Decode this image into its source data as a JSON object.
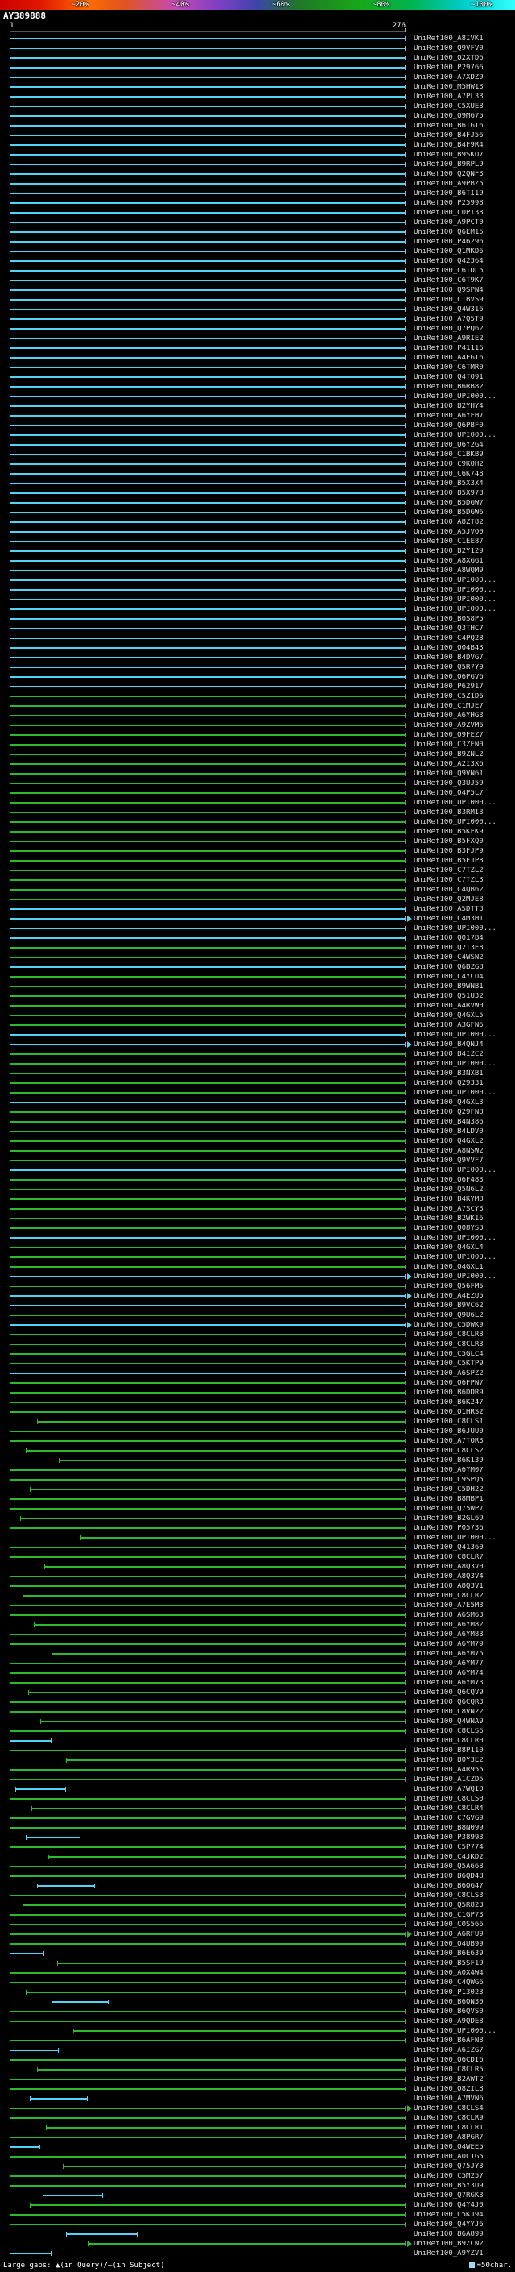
{
  "colors": {
    "high_identity": "#4fd4f7",
    "mid_identity": "#2db82d",
    "key_gradient": [
      "#cc0000",
      "#ff6a00",
      "#c44ab4",
      "#3c46a8",
      "#18a818",
      "#33ffff"
    ],
    "background": "#000000",
    "label_text": "#d8d8d8"
  },
  "footer": {
    "large_gaps_legend": "Large gaps: ▲(in Query)/—(in Subject)",
    "scale_legend": "=50char.",
    "scale_box_icon": "cyan-square"
  },
  "chart_data": {
    "type": "bar",
    "orientation": "horizontal",
    "title": "Sequence similarity hit overview (percent-identity colored alignments)",
    "query_name": "AY389888",
    "x_axis": {
      "min": 1,
      "max": 276,
      "start_label": "1",
      "end_label": "276"
    },
    "key": {
      "description": "percent identity color scale",
      "labels": [
        "~20%",
        "~40%",
        "~60%",
        "~80%",
        "~100%"
      ],
      "positions_pct": [
        15.5,
        35.0,
        54.5,
        74.0,
        93.5
      ]
    },
    "label_prefix": "UniRef100_",
    "bar_encoding": "[id, color(c=cyan ~100% identity, g=green ~60-80%), start, end, arrow_past_end]",
    "bars": [
      [
        "A8IVK1",
        "c"
      ],
      [
        "Q9VFV0",
        "c"
      ],
      [
        "Q2XTD6",
        "c"
      ],
      [
        "P29766",
        "c"
      ],
      [
        "A7XDZ9",
        "c"
      ],
      [
        "M5HW13",
        "c"
      ],
      [
        "A7PL33",
        "c"
      ],
      [
        "C5XUE8",
        "c"
      ],
      [
        "Q9M675",
        "c"
      ],
      [
        "B6TGT6",
        "c"
      ],
      [
        "B4FJ56",
        "c"
      ],
      [
        "B4F9R4",
        "c"
      ],
      [
        "B9SKO7",
        "c"
      ],
      [
        "B9RPL9",
        "c"
      ],
      [
        "Q2QNF3",
        "c"
      ],
      [
        "A9PBZ5",
        "c"
      ],
      [
        "B6TI19",
        "c"
      ],
      [
        "P25998",
        "c"
      ],
      [
        "C0PT38",
        "c"
      ],
      [
        "A9PCT0",
        "c"
      ],
      [
        "Q6EM15",
        "c"
      ],
      [
        "P46296",
        "c"
      ],
      [
        "Q1MKD6",
        "c"
      ],
      [
        "Q42364",
        "c"
      ],
      [
        "C6TDL5",
        "c"
      ],
      [
        "C6T9K7",
        "c"
      ],
      [
        "Q9SPN4",
        "c"
      ],
      [
        "C1BVS9",
        "c"
      ],
      [
        "Q4W316",
        "c"
      ],
      [
        "A7Q5T9",
        "c"
      ],
      [
        "Q7PQ62",
        "c"
      ],
      [
        "A9RIE2",
        "c"
      ],
      [
        "P41116",
        "c"
      ],
      [
        "A4FGI6",
        "c"
      ],
      [
        "C6TMR0",
        "c"
      ],
      [
        "Q4T091",
        "c"
      ],
      [
        "B6RB82",
        "c"
      ],
      [
        "UPI000...",
        "c"
      ],
      [
        "B2YHY4",
        "c"
      ],
      [
        "A6YFH7",
        "c"
      ],
      [
        "Q6PBF0",
        "c"
      ],
      [
        "UPI000...",
        "c"
      ],
      [
        "Q6Y2G4",
        "c"
      ],
      [
        "C1BKB9",
        "c"
      ],
      [
        "C9K0H2",
        "c"
      ],
      [
        "C6K748",
        "c"
      ],
      [
        "B5X3X4",
        "c"
      ],
      [
        "B5X978",
        "c"
      ],
      [
        "B5DGW7",
        "c"
      ],
      [
        "B5DGW6",
        "c"
      ],
      [
        "A8ZT82",
        "c"
      ],
      [
        "A5JVQ0",
        "c"
      ],
      [
        "C1EE87",
        "c"
      ],
      [
        "B2Y129",
        "c"
      ],
      [
        "A8XGG1",
        "c"
      ],
      [
        "A8WQM9",
        "c"
      ],
      [
        "UPI000...",
        "c"
      ],
      [
        "UPI000...",
        "c"
      ],
      [
        "UPI000...",
        "c"
      ],
      [
        "UPI000...",
        "c"
      ],
      [
        "B0S8P5",
        "c"
      ],
      [
        "Q3THC7",
        "c"
      ],
      [
        "C4PQ28",
        "c"
      ],
      [
        "Q04B43",
        "c"
      ],
      [
        "B4DVG7",
        "c"
      ],
      [
        "Q5R7Y0",
        "c"
      ],
      [
        "Q6PGV6",
        "c"
      ],
      [
        "P62917",
        "c"
      ],
      [
        "C5Z1D6",
        "g"
      ],
      [
        "C1MJE7",
        "g"
      ],
      [
        "A6YHG3",
        "g"
      ],
      [
        "A9ZVM6",
        "g"
      ],
      [
        "Q9FEZ7",
        "g"
      ],
      [
        "C3ZEN0",
        "g"
      ],
      [
        "B9ZNL2",
        "g"
      ],
      [
        "A2I3X6",
        "g"
      ],
      [
        "Q9VN61",
        "g"
      ],
      [
        "Q3UJ59",
        "g"
      ],
      [
        "Q4P5L7",
        "g"
      ],
      [
        "UPI000...",
        "g"
      ],
      [
        "B3RMI3",
        "g"
      ],
      [
        "UPI000...",
        "g"
      ],
      [
        "B5KFK9",
        "g"
      ],
      [
        "B5FXQ0",
        "g"
      ],
      [
        "B3FJP9",
        "g"
      ],
      [
        "B5FJP8",
        "g"
      ],
      [
        "C7TZL2",
        "g"
      ],
      [
        "C7TZL3",
        "g"
      ],
      [
        "C4QB62",
        "g"
      ],
      [
        "Q2MJE8",
        "g"
      ],
      [
        "A5DTT3",
        "c"
      ],
      [
        "C4M3H1",
        "c",
        1,
        276,
        1
      ],
      [
        "UPI000...",
        "c"
      ],
      [
        "Q017B4",
        "c"
      ],
      [
        "Q2I3E8",
        "g"
      ],
      [
        "C4WSN2",
        "g"
      ],
      [
        "Q6BZG8",
        "c"
      ],
      [
        "C4YCU4",
        "g"
      ],
      [
        "B9WNB1",
        "g"
      ],
      [
        "Q51U32",
        "g"
      ],
      [
        "A4RVW0",
        "g"
      ],
      [
        "Q4GXL5",
        "g"
      ],
      [
        "A3GFN6",
        "g"
      ],
      [
        "UPI000...",
        "c"
      ],
      [
        "B4QNJ4",
        "c",
        1,
        276,
        1
      ],
      [
        "B4IZC2",
        "g"
      ],
      [
        "UPI000...",
        "g"
      ],
      [
        "B3NXB1",
        "g"
      ],
      [
        "Q29331",
        "g"
      ],
      [
        "UPI000...",
        "g"
      ],
      [
        "Q4GXL3",
        "c"
      ],
      [
        "Q29FN8",
        "g"
      ],
      [
        "B4N386",
        "g"
      ],
      [
        "B4LDV0",
        "g"
      ],
      [
        "Q4GXL2",
        "g"
      ],
      [
        "A8NSW2",
        "g"
      ],
      [
        "Q9VVF7",
        "g"
      ],
      [
        "UPI000...",
        "c"
      ],
      [
        "Q6F483",
        "g"
      ],
      [
        "Q5N6L2",
        "g"
      ],
      [
        "B4KYM8",
        "g"
      ],
      [
        "A7SCY3",
        "g"
      ],
      [
        "B2WK16",
        "g"
      ],
      [
        "Q08YS3",
        "g"
      ],
      [
        "UPI000...",
        "c"
      ],
      [
        "Q4GXL4",
        "g"
      ],
      [
        "UPI000...",
        "g"
      ],
      [
        "Q4GXL1",
        "g"
      ],
      [
        "UPI000...",
        "c",
        1,
        276,
        1
      ],
      [
        "Q56FM5",
        "g"
      ],
      [
        "A4EZU5",
        "c",
        1,
        276,
        1
      ],
      [
        "B9VC62",
        "c"
      ],
      [
        "Q9U6L2",
        "g"
      ],
      [
        "C5DWK9",
        "c",
        1,
        276,
        1
      ],
      [
        "C8CLR8",
        "g"
      ],
      [
        "C8CLR3",
        "g"
      ],
      [
        "C5GLC4",
        "g"
      ],
      [
        "C5KTP9",
        "g"
      ],
      [
        "A6SPZ2",
        "c"
      ],
      [
        "Q6FPN7",
        "g"
      ],
      [
        "B6DDR9",
        "g"
      ],
      [
        "B6K247",
        "g"
      ],
      [
        "Q1HRS2",
        "g"
      ],
      [
        "C8CLS1",
        "g",
        20
      ],
      [
        "B6JUU0",
        "g"
      ],
      [
        "A7TQR3",
        "g"
      ],
      [
        "C8CLS2",
        "g",
        12
      ],
      [
        "B6K139",
        "g",
        35
      ],
      [
        "A6YM07",
        "g"
      ],
      [
        "C9SPQ5",
        "g"
      ],
      [
        "C5DH22",
        "g",
        15
      ],
      [
        "B8MBP1",
        "g"
      ],
      [
        "Q75WP7",
        "g"
      ],
      [
        "B2GL69",
        "g",
        8
      ],
      [
        "P05736",
        "g"
      ],
      [
        "UPI000...",
        "g",
        50
      ],
      [
        "Q41360",
        "g"
      ],
      [
        "C8CLR7",
        "g"
      ],
      [
        "A8Q3V0",
        "g",
        25
      ],
      [
        "A8Q3V4",
        "g"
      ],
      [
        "A8Q3V1",
        "g"
      ],
      [
        "C8CLR2",
        "g",
        10
      ],
      [
        "A7E5M3",
        "g"
      ],
      [
        "A6SM63",
        "g"
      ],
      [
        "A6YM82",
        "g",
        18
      ],
      [
        "A6YM83",
        "g"
      ],
      [
        "A6YM79",
        "g"
      ],
      [
        "A6YM75",
        "g",
        30
      ],
      [
        "A6YM77",
        "g"
      ],
      [
        "A6YM74",
        "g"
      ],
      [
        "A6YM73",
        "g"
      ],
      [
        "Q6CQV9",
        "g",
        14
      ],
      [
        "Q6CQR3",
        "g"
      ],
      [
        "C8VN22",
        "g"
      ],
      [
        "Q4WNA9",
        "g",
        22
      ],
      [
        "C8CLS6",
        "g"
      ],
      [
        "C8CLR0",
        "c",
        1,
        30
      ],
      [
        "B8P110",
        "g"
      ],
      [
        "B0Y3E2",
        "g",
        40
      ],
      [
        "A4R955",
        "g"
      ],
      [
        "A1CZD5",
        "g"
      ],
      [
        "A7WQI0",
        "c",
        5,
        40
      ],
      [
        "C8CLS0",
        "g"
      ],
      [
        "C8CLR4",
        "g",
        16
      ],
      [
        "C7GVG9",
        "g"
      ],
      [
        "B8N099",
        "g"
      ],
      [
        "P38993",
        "c",
        12,
        50
      ],
      [
        "C5P774",
        "g"
      ],
      [
        "C4JKD2",
        "g",
        28
      ],
      [
        "Q5A668",
        "g"
      ],
      [
        "B6QD48",
        "g"
      ],
      [
        "B6QG47",
        "c",
        20,
        60
      ],
      [
        "C8CLS3",
        "g"
      ],
      [
        "Q5R823",
        "g",
        10
      ],
      [
        "C1GP73",
        "g"
      ],
      [
        "C0S566",
        "g"
      ],
      [
        "A6RFU9",
        "g",
        1,
        276,
        1
      ],
      [
        "Q4UB99",
        "g"
      ],
      [
        "B6E639",
        "c",
        1,
        25
      ],
      [
        "B5SF19",
        "g",
        34
      ],
      [
        "A0X4W4",
        "g"
      ],
      [
        "C4QWG6",
        "g"
      ],
      [
        "P13023",
        "g",
        12
      ],
      [
        "B6QN30",
        "c",
        30,
        70
      ],
      [
        "B6QVS0",
        "g"
      ],
      [
        "A9QDE8",
        "g"
      ],
      [
        "UPI000...",
        "g",
        45
      ],
      [
        "B6AFN8",
        "g"
      ],
      [
        "A6IZG7",
        "c",
        1,
        35
      ],
      [
        "Q6CDI6",
        "g"
      ],
      [
        "C8CLR5",
        "g",
        20
      ],
      [
        "B2AWT2",
        "g"
      ],
      [
        "Q8ZIL8",
        "g"
      ],
      [
        "A7MVN6",
        "c",
        15,
        55
      ],
      [
        "C8CLS4",
        "g",
        1,
        276,
        1
      ],
      [
        "C8CLR9",
        "g"
      ],
      [
        "C8CLR1",
        "g",
        26
      ],
      [
        "A8PGR7",
        "g"
      ],
      [
        "Q4WEE5",
        "c",
        1,
        22
      ],
      [
        "A0C1G5",
        "g"
      ],
      [
        "Q75JY3",
        "g",
        38
      ],
      [
        "C5M257",
        "g"
      ],
      [
        "B5Y3U9",
        "g"
      ],
      [
        "Q7RGK3",
        "c",
        24,
        66
      ],
      [
        "Q4Y4J0",
        "g",
        15
      ],
      [
        "C5KJ94",
        "g"
      ],
      [
        "Q4YYJ6",
        "g"
      ],
      [
        "B6A899",
        "c",
        40,
        90
      ],
      [
        "B9ZCN2",
        "g",
        55,
        276,
        1
      ],
      [
        "A9YZV1",
        "c",
        1,
        30
      ]
    ]
  }
}
